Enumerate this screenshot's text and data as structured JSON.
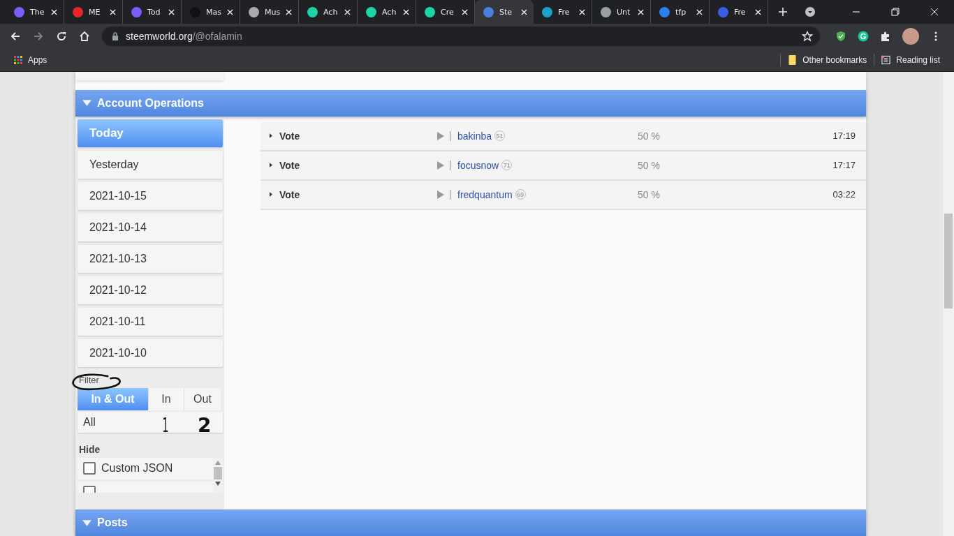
{
  "browser": {
    "tabs": [
      {
        "title": "The",
        "color": "#7c5cff",
        "selected": false
      },
      {
        "title": "ME",
        "color": "#e8262b",
        "selected": false
      },
      {
        "title": "Tod",
        "color": "#7c5cff",
        "selected": false
      },
      {
        "title": "Mas",
        "color": "#111111",
        "selected": false
      },
      {
        "title": "Mus",
        "color": "#aaaaaa",
        "selected": false
      },
      {
        "title": "Ach",
        "color": "#1dd3a7",
        "selected": false
      },
      {
        "title": "Ach",
        "color": "#1dd3a7",
        "selected": false
      },
      {
        "title": "Cre",
        "color": "#1dd3a7",
        "selected": false
      },
      {
        "title": "Ste",
        "color": "#4a7fe0",
        "selected": true
      },
      {
        "title": "Fre",
        "color": "#1ba0c8",
        "selected": false
      },
      {
        "title": "Unt",
        "color": "#9aa0a6",
        "selected": false
      },
      {
        "title": "tfp",
        "color": "#2d7ff0",
        "selected": false
      },
      {
        "title": "Fre",
        "color": "#3a5ee8",
        "selected": false
      }
    ],
    "url_host": "steemworld.org",
    "url_path": "/@ofalamin",
    "bookmarks": [
      "Apps"
    ],
    "other_bookmarks": "Other bookmarks",
    "reading_list": "Reading list"
  },
  "section": {
    "title": "Account Operations",
    "expanded": true
  },
  "days": [
    {
      "label": "Today",
      "selected": true
    },
    {
      "label": "Yesterday",
      "selected": false
    },
    {
      "label": "2021-10-15",
      "selected": false
    },
    {
      "label": "2021-10-14",
      "selected": false
    },
    {
      "label": "2021-10-13",
      "selected": false
    },
    {
      "label": "2021-10-12",
      "selected": false
    },
    {
      "label": "2021-10-11",
      "selected": false
    },
    {
      "label": "2021-10-10",
      "selected": false
    }
  ],
  "filter": {
    "label": "Filter",
    "directions": [
      {
        "label": "In & Out",
        "selected": true
      },
      {
        "label": "In",
        "selected": false
      },
      {
        "label": "Out",
        "selected": false
      }
    ],
    "type": "All"
  },
  "hide": {
    "label": "Hide",
    "items": [
      {
        "label": "Custom JSON",
        "checked": false
      },
      {
        "checked": false
      }
    ]
  },
  "operations": [
    {
      "type": "Vote",
      "account": "bakinba",
      "reputation": "51",
      "weight": "50 %",
      "time": "17:19"
    },
    {
      "type": "Vote",
      "account": "focusnow",
      "reputation": "71",
      "weight": "50 %",
      "time": "17:17"
    },
    {
      "type": "Vote",
      "account": "fredquantum",
      "reputation": "69",
      "weight": "50 %",
      "time": "03:22"
    }
  ],
  "next_section": {
    "title": "Posts"
  },
  "annotations": [
    "1",
    "2"
  ]
}
